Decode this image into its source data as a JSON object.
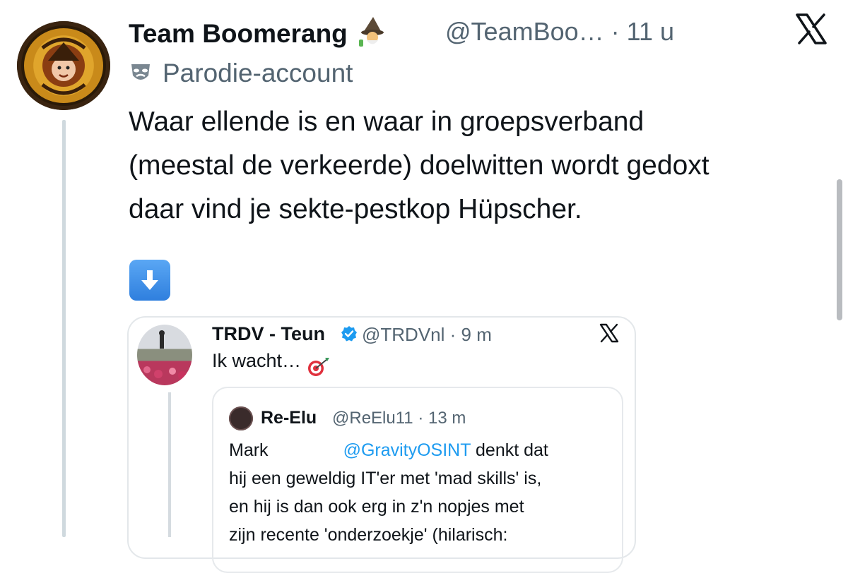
{
  "tweet": {
    "author_name": "Team Boomerang",
    "author_handle": "@TeamBoo…",
    "separator": "·",
    "time": "11 u",
    "label": "Parodie-account",
    "text_lines": [
      "Waar ellende is en waar in groepsverband",
      "(meestal de verkeerde) doelwitten wordt gedoxt",
      "daar vind je sekte-pestkop Hüpscher."
    ]
  },
  "quote": {
    "author_name": "TRDV - Teun",
    "author_handle": "@TRDVnl",
    "separator": "·",
    "time": "9 m",
    "text": "Ik wacht…",
    "inner": {
      "author_name": "Re-Elu",
      "author_handle": "@ReElu11",
      "separator": "·",
      "time": "13 m",
      "line1_start": "Mark",
      "line1_mention": "@GravityOSINT",
      "line1_end": " denkt dat",
      "line2": "hij een geweldig IT'er met 'mad skills' is,",
      "line3": "en hij is dan ook erg in z'n nopjes met",
      "line4": "zijn recente 'onderzoekje' (hilarisch:"
    }
  },
  "icons": {
    "close": "x-logo-icon",
    "parody": "parody-mask-icon",
    "emoji_author": "wizard-emoji-icon",
    "emoji_arrow": "down-arrow-emoji-icon",
    "emoji_target": "target-emoji-icon",
    "verified": "verified-badge-icon"
  },
  "colors": {
    "text": "#0f1419",
    "secondary": "#536471",
    "link": "#1d9bf0",
    "verified": "#1d9bf0"
  }
}
